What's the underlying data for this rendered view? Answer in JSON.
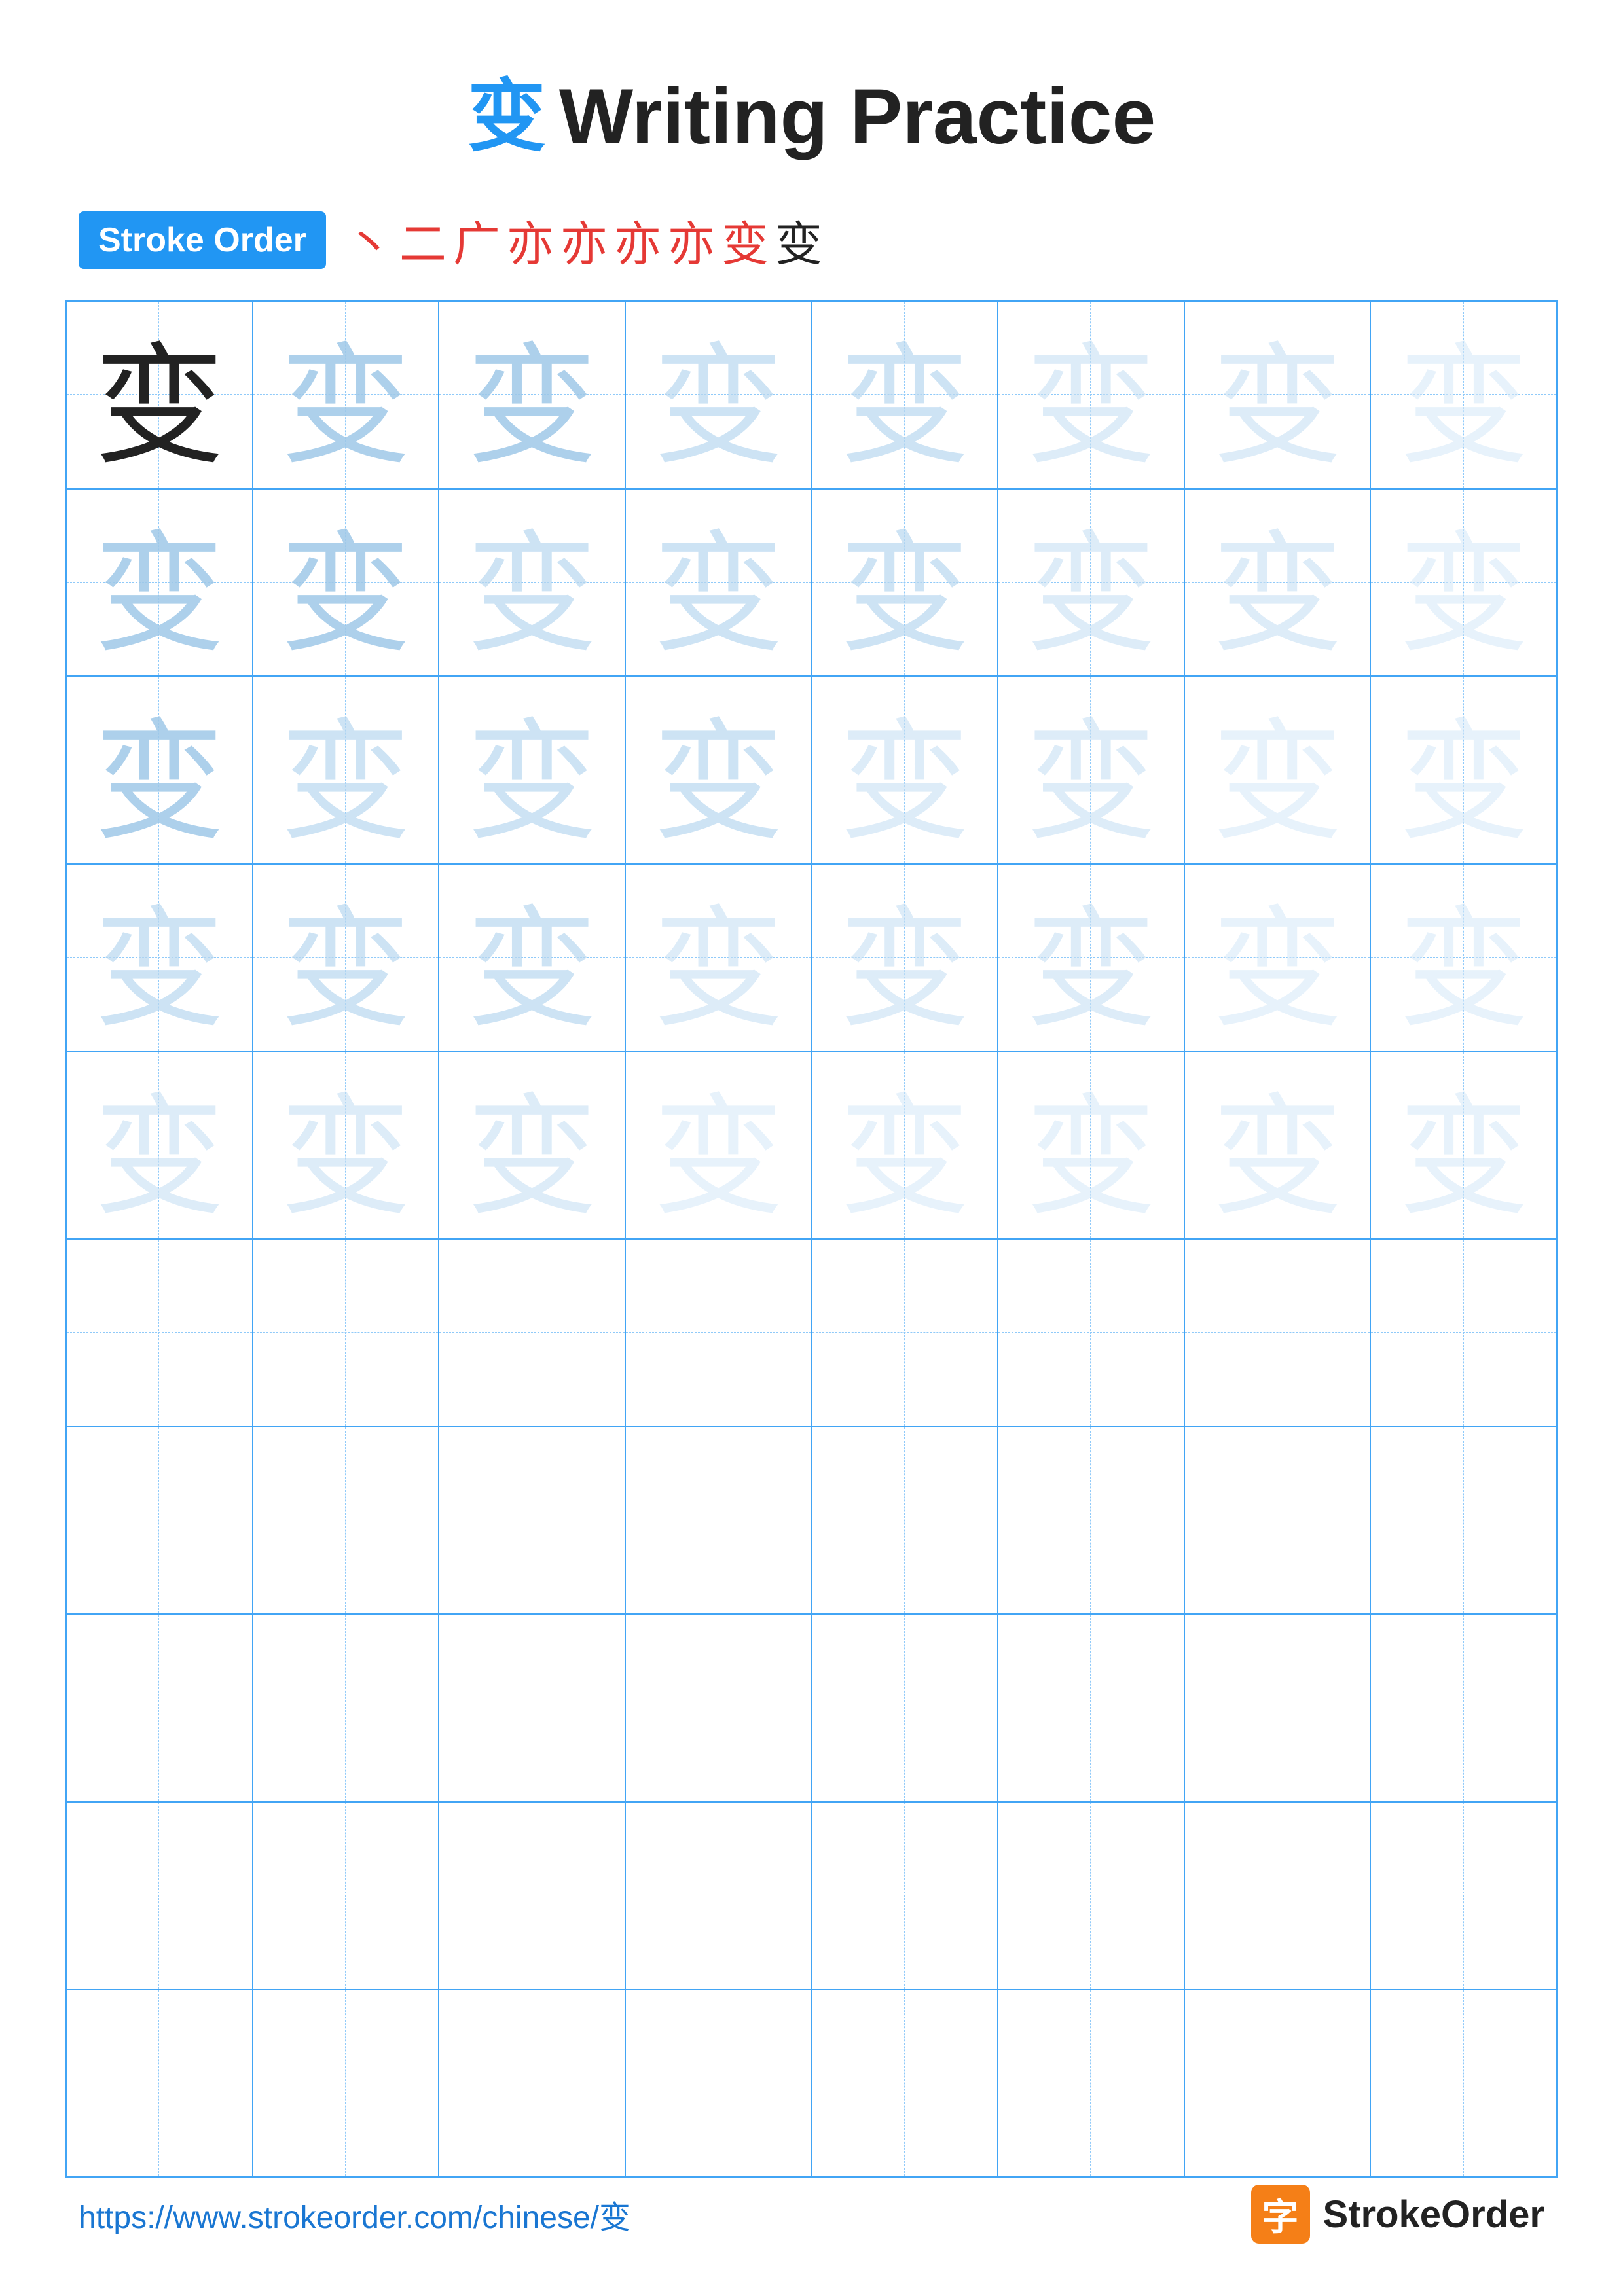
{
  "title": {
    "char": "变",
    "text": "Writing Practice"
  },
  "stroke_order": {
    "badge_label": "Stroke Order",
    "strokes": [
      "丶",
      "二",
      "广",
      "亦",
      "亦",
      "亦",
      "亦",
      "变",
      "变"
    ]
  },
  "grid": {
    "rows": 10,
    "cols": 8,
    "char": "变",
    "practice_rows": 5,
    "empty_rows": 5
  },
  "footer": {
    "url": "https://www.strokeorder.com/chinese/变",
    "brand": "StrokeOrder",
    "brand_char": "字"
  }
}
